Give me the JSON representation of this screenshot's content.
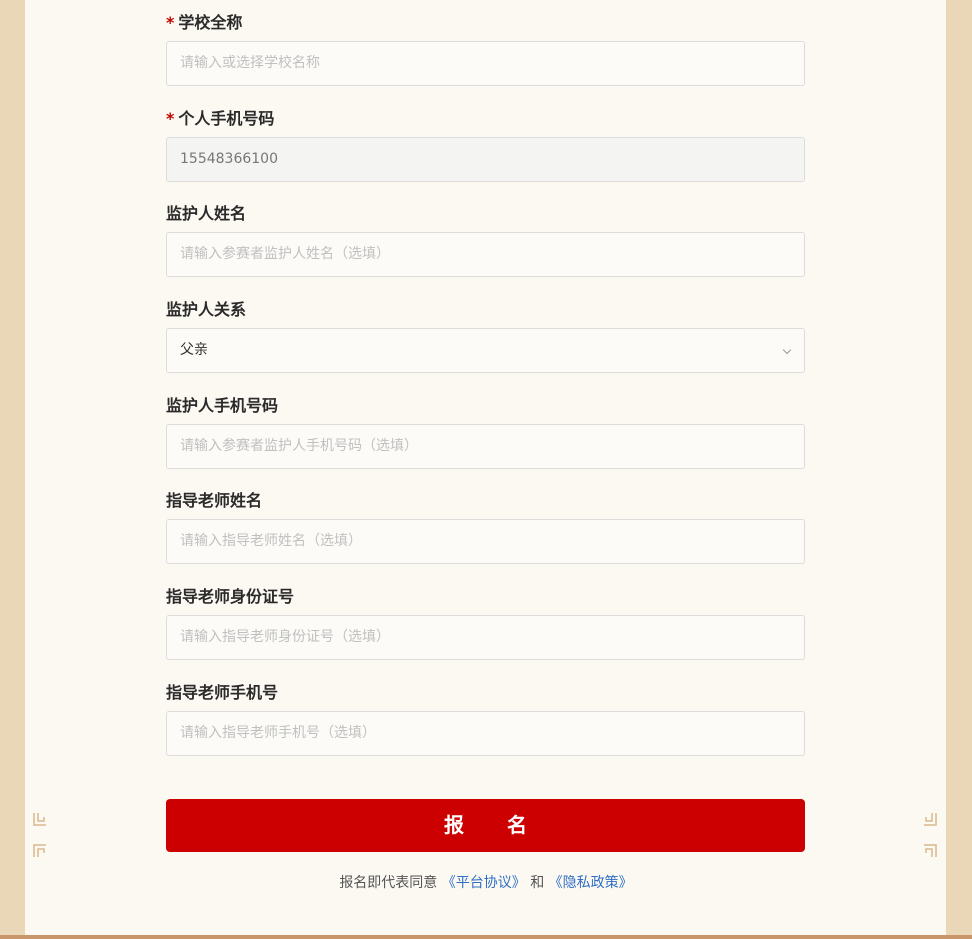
{
  "form": {
    "required_mark": "*",
    "fields": [
      {
        "label": "学校全称",
        "required": true,
        "type": "input",
        "placeholder": "请输入或选择学校名称"
      },
      {
        "label": "个人手机号码",
        "required": true,
        "type": "input",
        "disabled": true,
        "value": "15548366100"
      },
      {
        "label": "监护人姓名",
        "required": false,
        "type": "input",
        "placeholder": "请输入参赛者监护人姓名（选填）"
      },
      {
        "label": "监护人关系",
        "required": false,
        "type": "select",
        "value": "父亲",
        "icon": "chevron-down-icon"
      },
      {
        "label": "监护人手机号码",
        "required": false,
        "type": "input",
        "placeholder": "请输入参赛者监护人手机号码（选填）"
      },
      {
        "label": "指导老师姓名",
        "required": false,
        "type": "input",
        "placeholder": "请输入指导老师姓名（选填）"
      },
      {
        "label": "指导老师身份证号",
        "required": false,
        "type": "input",
        "placeholder": "请输入指导老师身份证号（选填）"
      },
      {
        "label": "指导老师手机号",
        "required": false,
        "type": "input",
        "placeholder": "请输入指导老师手机号（选填）"
      }
    ]
  },
  "submit": {
    "label": "报 名",
    "color": "#cc0000"
  },
  "agreement": {
    "prefix": "报名即代表同意",
    "platform_link": "《平台协议》",
    "conjunction": "和",
    "privacy_link": "《隐私政策》",
    "link_color": "#2f6fc4"
  },
  "colors": {
    "page_bg": "#ead7b8",
    "paper_bg": "#fcf9f3",
    "required": "#c00000"
  }
}
